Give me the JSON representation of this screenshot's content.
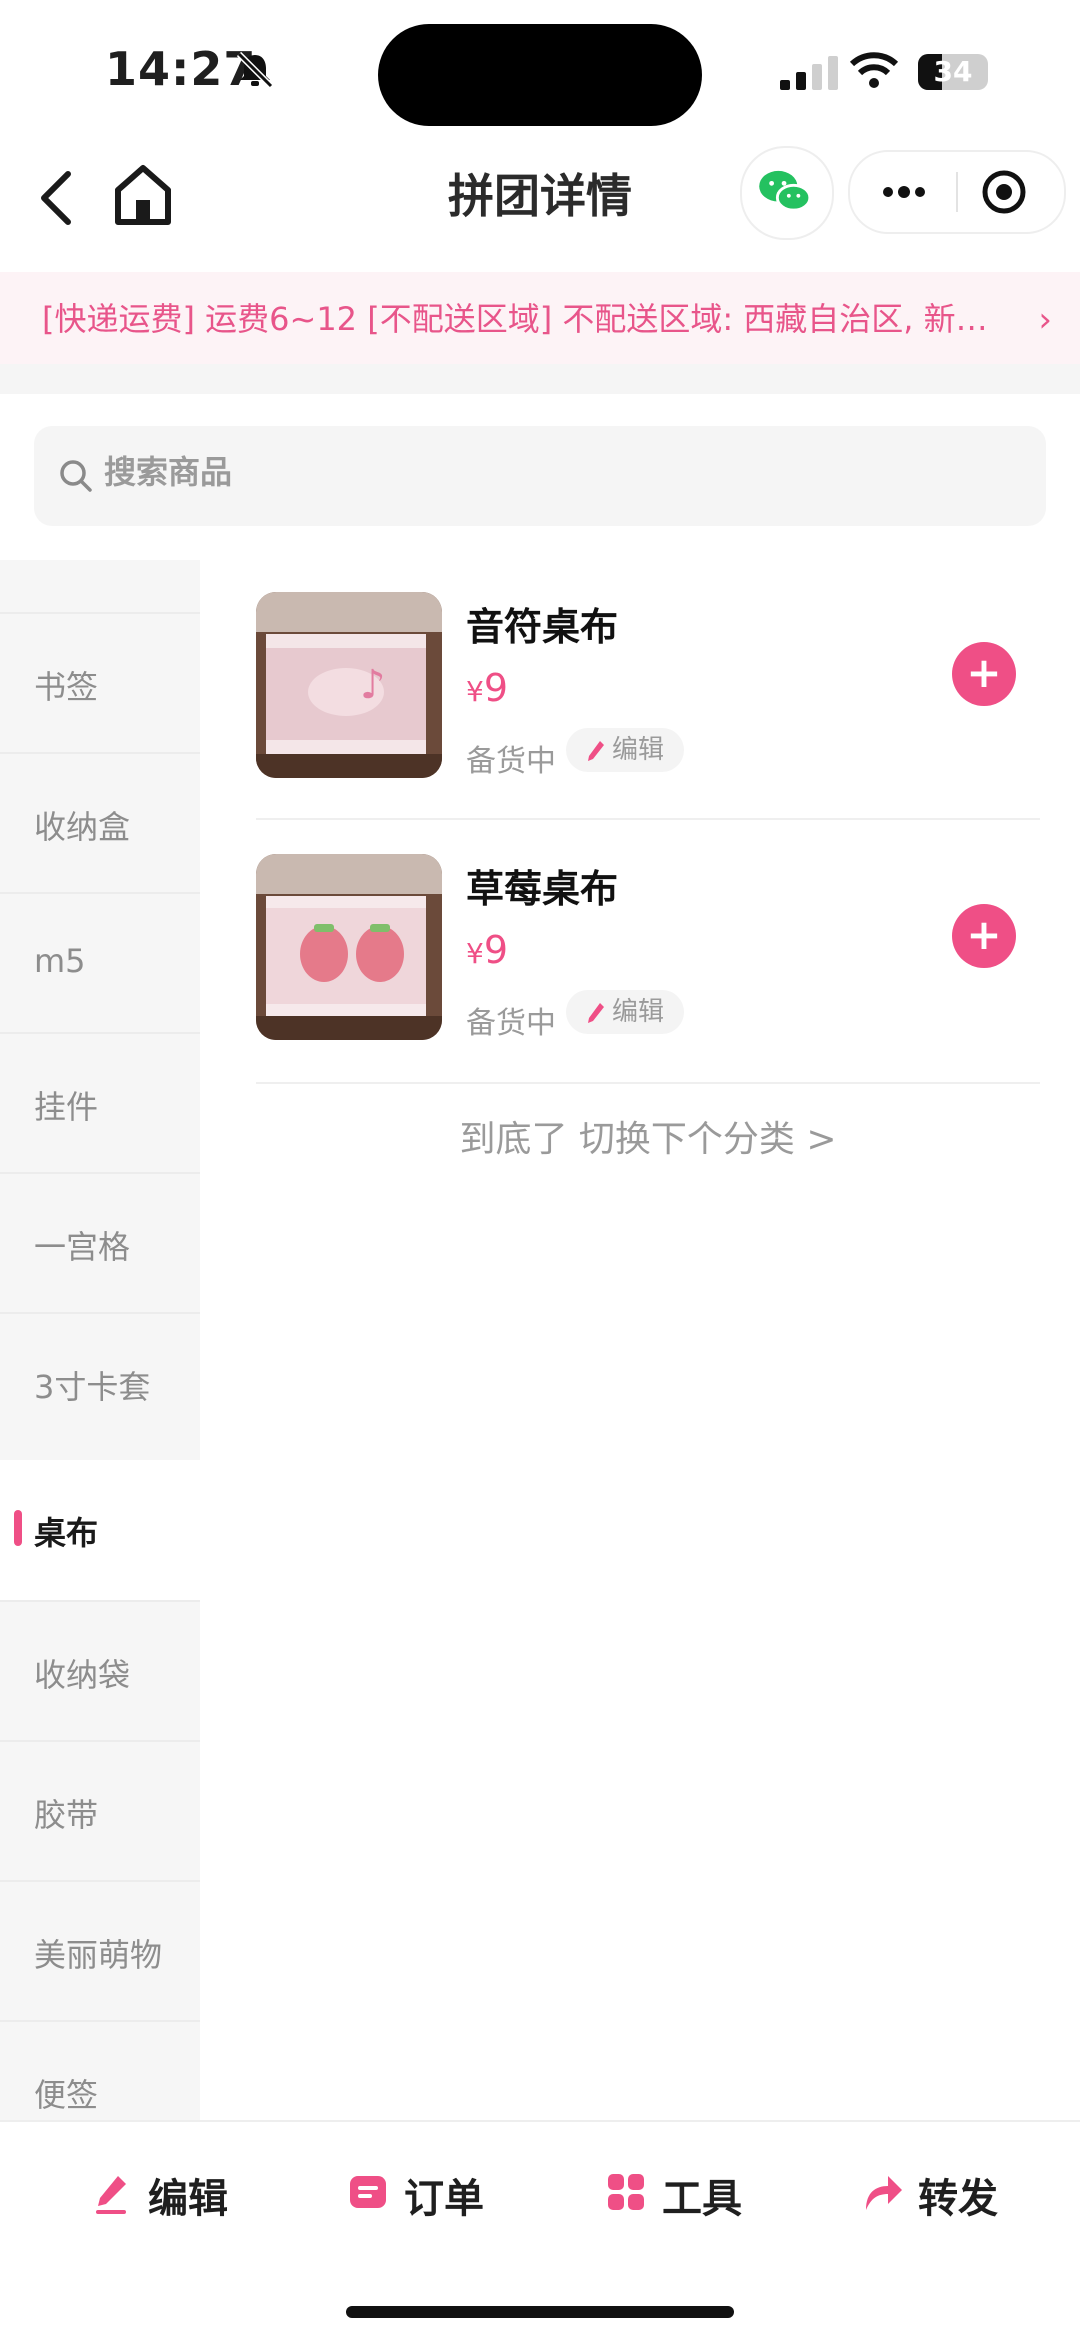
{
  "status_bar": {
    "time": "14:27",
    "battery": "34"
  },
  "nav": {
    "title": "拼团详情"
  },
  "notice": {
    "text": "[快递运费] 运费6~12 [不配送区域] 不配送区域: 西藏自治区, 新疆维吾尔自治区",
    "arrow": "›"
  },
  "search": {
    "placeholder": "搜索商品"
  },
  "sidebar": {
    "items": [
      {
        "label": "书签"
      },
      {
        "label": "收纳盒"
      },
      {
        "label": "m5"
      },
      {
        "label": "挂件"
      },
      {
        "label": "一宫格"
      },
      {
        "label": "3寸卡套"
      },
      {
        "label": "桌布",
        "active": true
      },
      {
        "label": "收纳袋"
      },
      {
        "label": "胶带"
      },
      {
        "label": "美丽萌物"
      },
      {
        "label": "便签"
      }
    ]
  },
  "products": [
    {
      "name": "音符桌布",
      "currency": "¥",
      "price": "9",
      "status": "备货中",
      "edit_label": "编辑",
      "add_label": "+"
    },
    {
      "name": "草莓桌布",
      "currency": "¥",
      "price": "9",
      "status": "备货中",
      "edit_label": "编辑",
      "add_label": "+"
    }
  ],
  "end_tip": "到底了 切换下个分类 >",
  "tabbar": {
    "items": [
      {
        "label": "编辑",
        "icon": "pencil-icon"
      },
      {
        "label": "订单",
        "icon": "order-icon"
      },
      {
        "label": "工具",
        "icon": "grid-icon"
      },
      {
        "label": "转发",
        "icon": "share-icon"
      }
    ]
  },
  "colors": {
    "accent": "#ef4f86",
    "notice_bg": "#fdf3f6",
    "sidebar_bg": "#f6f6f6"
  }
}
